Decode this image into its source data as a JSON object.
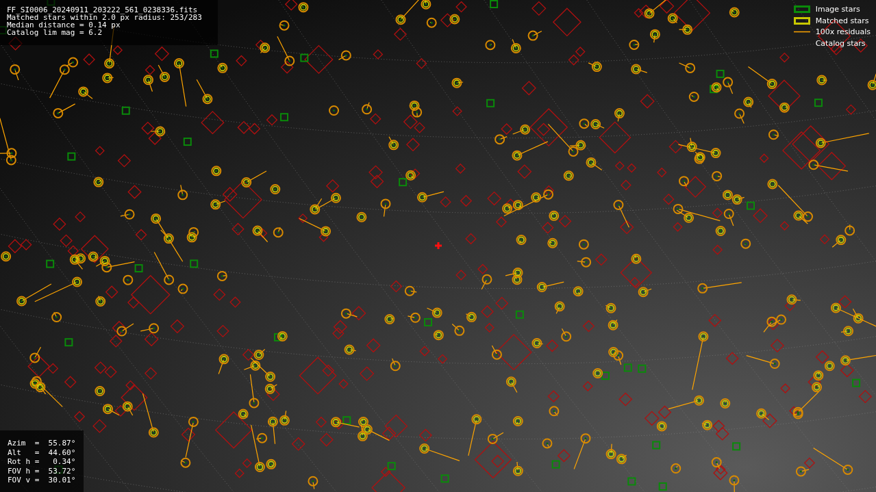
{
  "header": {
    "lines": [
      "FF_SI0006_20240911_203222_561_0238336.fits",
      "Matched stars within 2.0 px radius: 253/283",
      "Median distance = 0.14 px",
      "Catalog lim mag = 6.2"
    ]
  },
  "legend": [
    {
      "kind": "image",
      "label": "Image stars",
      "color": "#0a8a0a"
    },
    {
      "kind": "matched",
      "label": "Matched stars",
      "color": "#c8c800"
    },
    {
      "kind": "residual",
      "label": "100x residuals",
      "color": "#ffa500"
    },
    {
      "kind": "catalog",
      "label": "Catalog stars"
    }
  ],
  "pointing": {
    "lines": [
      "Azim  =  55.87°",
      "Alt   =  44.60°",
      "Rot h =   0.34°",
      "FOV h =  53.72°",
      "FOV v =  30.01°"
    ]
  }
}
